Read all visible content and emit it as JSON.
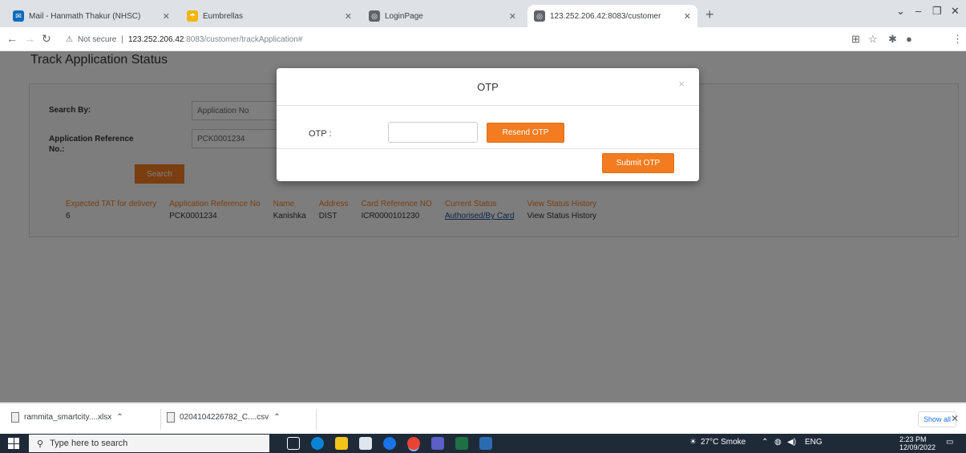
{
  "browser": {
    "tabs": [
      {
        "title": "Mail - Hanmath Thakur (NHSC)",
        "active": false,
        "favicon_color": "#0f6cbd"
      },
      {
        "title": "Eumbrellas",
        "active": false,
        "favicon_color": "#f4b400"
      },
      {
        "title": "LoginPage",
        "active": false,
        "favicon_color": "#5f6368"
      },
      {
        "title": "123.252.206.42:8083/customer",
        "active": true,
        "favicon_color": "#5f6368"
      }
    ],
    "new_tab_glyph": "+",
    "address": {
      "warning": "Not secure",
      "host": "123.252.206.42",
      "path": ":8083/customer/trackApplication#"
    }
  },
  "page": {
    "title": "Track Application Status",
    "search_by_label": "Search By:",
    "search_by_value": "Application No",
    "app_ref_label": "Application Reference No.:",
    "app_ref_value": "PCK0001234",
    "search_button": "Search",
    "results": {
      "headers": [
        "Expected TAT for delivery",
        "Application Reference No",
        "Name",
        "Address",
        "Card Reference NO",
        "Current Status",
        "View Status History"
      ],
      "row": [
        "6",
        "PCK0001234",
        "Kanishka",
        "DIST",
        "ICR0000101230",
        "Authorised/By Card",
        "View Status History"
      ]
    }
  },
  "modal": {
    "title": "OTP",
    "close_glyph": "×",
    "otp_label": "OTP :",
    "otp_value": "",
    "resend_button": "Resend OTP",
    "submit_button": "Submit OTP"
  },
  "downloads": {
    "items": [
      "rammita_smartcity....xlsx",
      "0204104226782_C....csv"
    ],
    "show_all": "Show all"
  },
  "taskbar": {
    "search_placeholder": "Type here to search",
    "weather": "27°C Smoke",
    "lang": "ENG",
    "time": "2:23 PM",
    "date": "12/09/2022"
  },
  "colors": {
    "accent": "#f47c20",
    "overlay": "rgba(0,0,0,0.5)",
    "taskbar": "#1e2a38"
  }
}
